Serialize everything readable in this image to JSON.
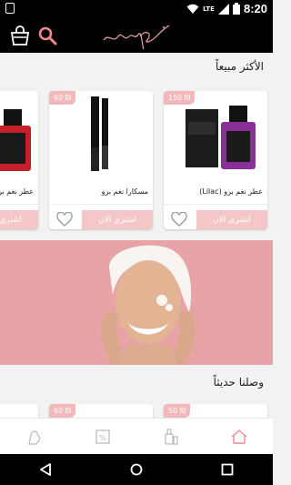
{
  "status_bar": {
    "network": "LTE",
    "time": "8:20"
  },
  "app": {
    "logo_text": "np"
  },
  "sections": {
    "best_sellers_title": "الأكثر مبيعاً",
    "new_arrivals_title": "وصلنا حديثاً"
  },
  "products": [
    {
      "price": "150 ₪",
      "name": "عطر نغم برو (Lilac)",
      "buy_label": "اشتري الان"
    },
    {
      "price": "60 ₪",
      "name": "مسكارا نغم برو",
      "buy_label": "اشتري الان"
    },
    {
      "price": "",
      "name": "عطر نغم برو",
      "buy_label": "اشتري الان"
    }
  ],
  "new_products": [
    {
      "price": "50 ₪"
    },
    {
      "price": "60 ₪"
    }
  ],
  "colors": {
    "accent": "#f4c6c8",
    "price_tag": "#f2b8bb",
    "banner_bg": "#e8a3a6"
  },
  "bottom_nav": [
    "hand-cream-icon",
    "coupon-icon",
    "bottles-icon",
    "home-icon"
  ]
}
